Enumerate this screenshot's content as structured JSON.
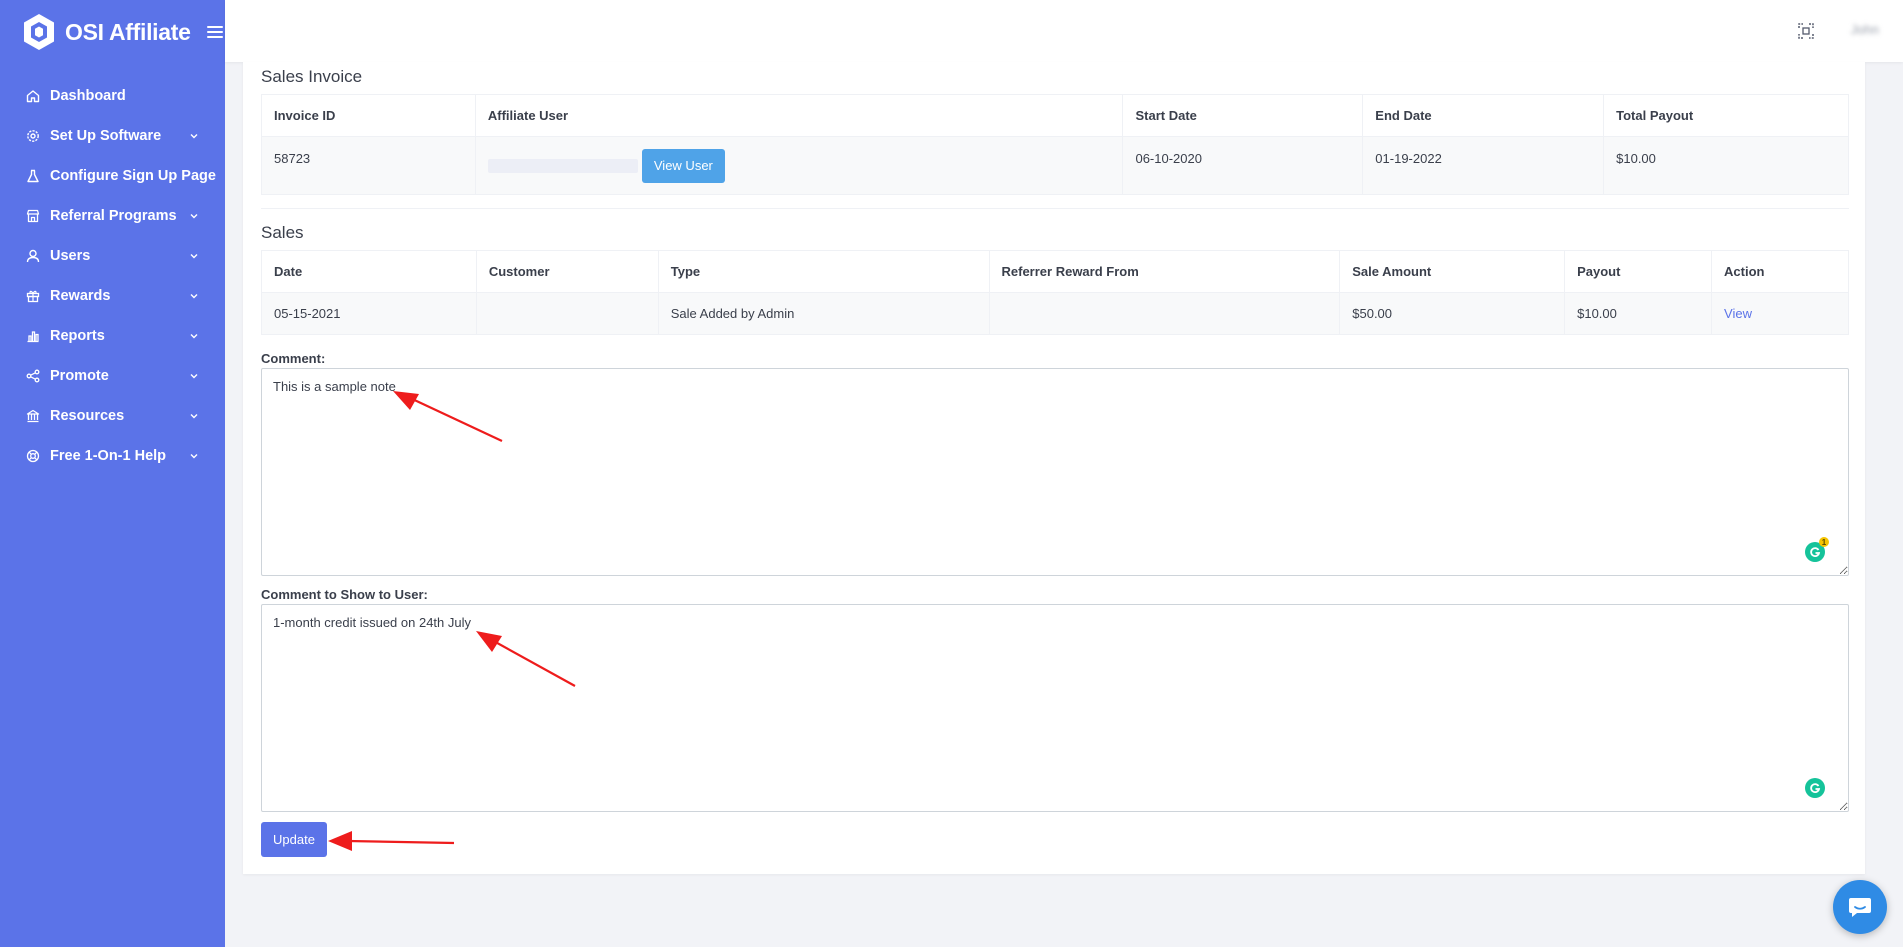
{
  "brand": {
    "name": "OSI Affiliate"
  },
  "topbar": {
    "user_name": "John"
  },
  "sidebar": {
    "items": [
      {
        "label": "Dashboard",
        "icon": "home-icon",
        "expandable": false
      },
      {
        "label": "Set Up Software",
        "icon": "gear-icon",
        "expandable": true
      },
      {
        "label": "Configure Sign Up Page",
        "icon": "flask-icon",
        "expandable": false
      },
      {
        "label": "Referral Programs",
        "icon": "store-icon",
        "expandable": true
      },
      {
        "label": "Users",
        "icon": "user-icon",
        "expandable": true
      },
      {
        "label": "Rewards",
        "icon": "gift-icon",
        "expandable": true
      },
      {
        "label": "Reports",
        "icon": "chart-icon",
        "expandable": true
      },
      {
        "label": "Promote",
        "icon": "share-icon",
        "expandable": true
      },
      {
        "label": "Resources",
        "icon": "bank-icon",
        "expandable": true
      },
      {
        "label": "Free 1-On-1 Help",
        "icon": "lifebuoy-icon",
        "expandable": true
      }
    ]
  },
  "invoice": {
    "title": "Sales Invoice",
    "headers": [
      "Invoice ID",
      "Affiliate User",
      "Start Date",
      "End Date",
      "Total Payout"
    ],
    "row": {
      "invoice_id": "58723",
      "view_user_label": "View User",
      "start_date": "06-10-2020",
      "end_date": "01-19-2022",
      "total_payout": "$10.00"
    }
  },
  "sales": {
    "title": "Sales",
    "headers": [
      "Date",
      "Customer",
      "Type",
      "Referrer Reward From",
      "Sale Amount",
      "Payout",
      "Action"
    ],
    "rows": [
      {
        "date": "05-15-2021",
        "customer": "",
        "type": "Sale Added by Admin",
        "referrer_reward_from": "",
        "sale_amount": "$50.00",
        "payout": "$10.00",
        "action": "View"
      }
    ]
  },
  "form": {
    "comment_label": "Comment:",
    "comment_value": "This is a sample note",
    "user_comment_label": "Comment to Show to User:",
    "user_comment_value": "1-month credit issued on 24th July",
    "update_label": "Update",
    "grammarly_count": "1"
  },
  "colors": {
    "sidebar": "#5b73e8",
    "button_info": "#4fa3e8",
    "annotation_arrow": "#ee1c1c",
    "chat": "#2f8be5"
  }
}
